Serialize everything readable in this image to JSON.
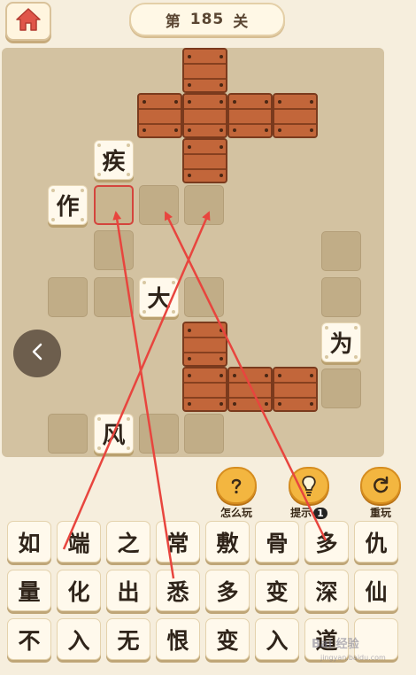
{
  "header": {
    "level_prefix": "第",
    "level_number": "185",
    "level_suffix": "关"
  },
  "board": {
    "tiles": [
      "疾",
      "作",
      "大",
      "为",
      "风"
    ]
  },
  "controls": {
    "how_to_play": "怎么玩",
    "hint": "提示",
    "hint_count": "1",
    "replay": "重玩"
  },
  "keyboard": {
    "row1": [
      "如",
      "端",
      "之",
      "常",
      "敷",
      "骨",
      "多",
      "仇"
    ],
    "row2": [
      "量",
      "化",
      "出",
      "悉",
      "多",
      "变",
      "深",
      "仙"
    ],
    "row3": [
      "不",
      "入",
      "无",
      "恨",
      "变",
      "入",
      "道",
      ""
    ]
  },
  "watermark": {
    "text": "Bai 经验",
    "url": "jingyan.baidu.com"
  },
  "colors": {
    "background": "#f6eedd",
    "board": "#d3c2a1",
    "plank": "#b4582f",
    "arrow": "#e8453e",
    "button": "#f3b640"
  }
}
